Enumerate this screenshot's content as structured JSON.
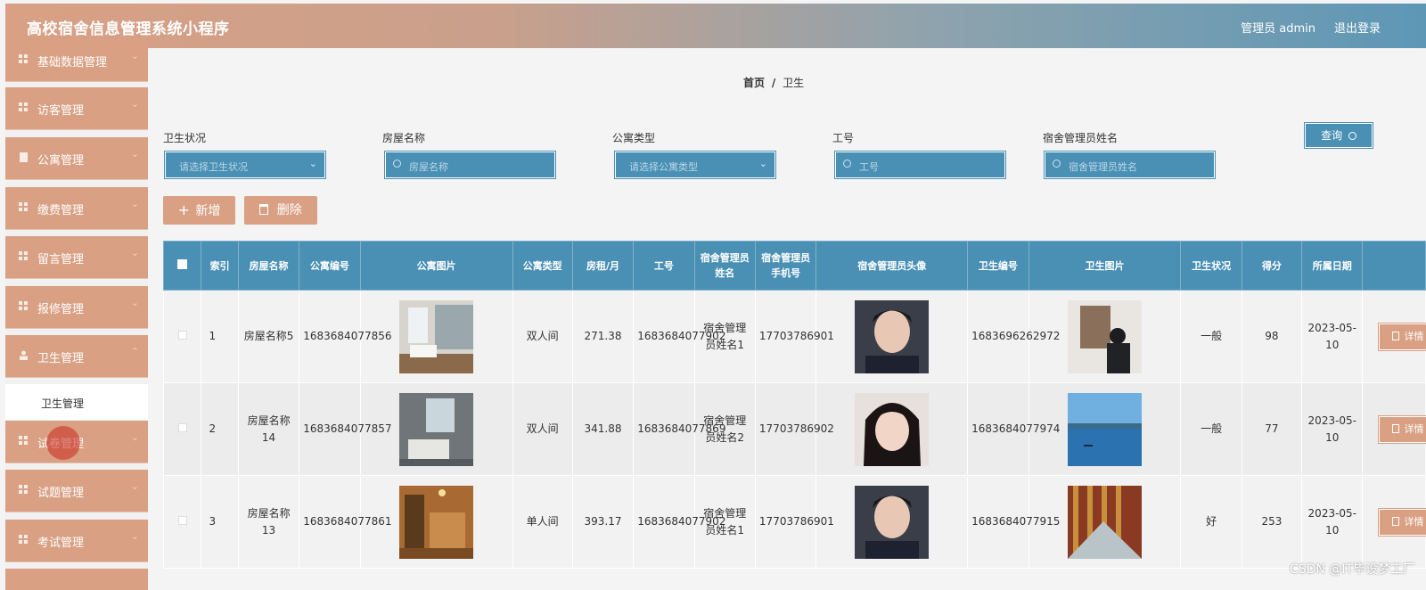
{
  "app": {
    "title": "高校宿舍信息管理系统小程序",
    "admin": "管理员 admin",
    "logout": "退出登录"
  },
  "sidebar": {
    "items": [
      {
        "label": "基础数据管理"
      },
      {
        "label": "访客管理"
      },
      {
        "label": "公寓管理"
      },
      {
        "label": "缴费管理"
      },
      {
        "label": "留言管理"
      },
      {
        "label": "报修管理"
      },
      {
        "label": "卫生管理"
      },
      {
        "label": "试卷管理"
      },
      {
        "label": "试题管理"
      },
      {
        "label": "考试管理"
      }
    ],
    "sub_item": "卫生管理"
  },
  "breadcrumb": {
    "home": "首页",
    "sep": "/",
    "current": "卫生"
  },
  "filters": [
    {
      "label": "卫生状况",
      "placeholder": "请选择卫生状况",
      "type": "select"
    },
    {
      "label": "房屋名称",
      "placeholder": "房屋名称",
      "type": "search"
    },
    {
      "label": "公寓类型",
      "placeholder": "请选择公寓类型",
      "type": "select"
    },
    {
      "label": "工号",
      "placeholder": "工号",
      "type": "search"
    },
    {
      "label": "宿舍管理员姓名",
      "placeholder": "宿舍管理员姓名",
      "type": "search"
    }
  ],
  "buttons": {
    "query": "查询",
    "add": "新增",
    "delete": "删除",
    "detail": "详情"
  },
  "table": {
    "headers": [
      "索引",
      "房屋名称",
      "公寓编号",
      "公寓图片",
      "公寓类型",
      "房租/月",
      "工号",
      "宿舍管理员姓名",
      "宿舍管理员手机号",
      "宿舍管理员头像",
      "卫生编号",
      "卫生图片",
      "卫生状况",
      "得分",
      "所属日期"
    ],
    "rows": [
      {
        "index": "1",
        "house": "房屋名称5",
        "apt_no": "1683684077856",
        "apt_type": "双人间",
        "rent": "271.38",
        "work_no": "1683684077902",
        "manager": "宿舍管理员姓名1",
        "phone": "17703786901",
        "hyg_no": "1683696262972",
        "status": "一般",
        "score": "98",
        "date": "2023-05-10"
      },
      {
        "index": "2",
        "house": "房屋名称14",
        "apt_no": "1683684077857",
        "apt_type": "双人间",
        "rent": "341.88",
        "work_no": "1683684077869",
        "manager": "宿舍管理员姓名2",
        "phone": "17703786902",
        "hyg_no": "1683684077974",
        "status": "一般",
        "score": "77",
        "date": "2023-05-10"
      },
      {
        "index": "3",
        "house": "房屋名称13",
        "apt_no": "1683684077861",
        "apt_type": "单人间",
        "rent": "393.17",
        "work_no": "1683684077902",
        "manager": "宿舍管理员姓名1",
        "phone": "17703786901",
        "hyg_no": "1683684077915",
        "status": "好",
        "score": "253",
        "date": "2023-05-10"
      }
    ]
  },
  "watermark": "CSDN @IT毕设梦工厂",
  "colors": {
    "primary": "#4a90b5",
    "accent": "#d9a084"
  }
}
